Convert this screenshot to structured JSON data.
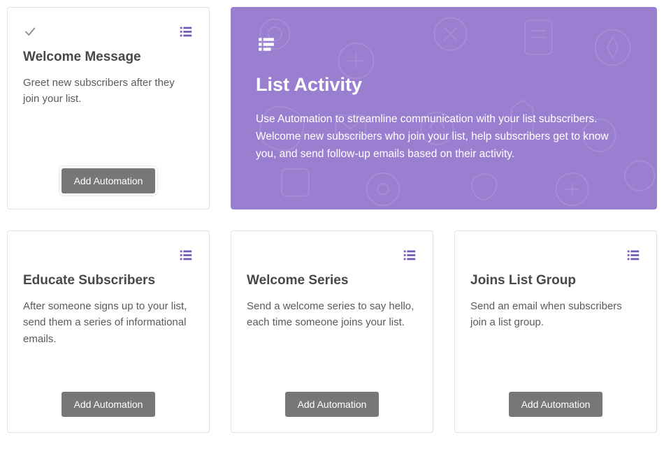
{
  "feature": {
    "title": "List Activity",
    "description": "Use Automation to streamline communication with your list subscribers. Welcome new subscribers who join your list, help subscribers get to know you, and send follow-up emails based on their activity."
  },
  "cards": {
    "welcome_message": {
      "title": "Welcome Message",
      "description": "Greet new subscribers after they join your list.",
      "button": "Add Automation"
    },
    "educate": {
      "title": "Educate Subscribers",
      "description": "After someone signs up to your list, send them a series of informational emails.",
      "button": "Add Automation"
    },
    "welcome_series": {
      "title": "Welcome Series",
      "description": "Send a welcome series to say hello, each time someone joins your list.",
      "button": "Add Automation"
    },
    "joins_group": {
      "title": "Joins List Group",
      "description": "Send an email when subscribers join a list group.",
      "button": "Add Automation"
    }
  },
  "colors": {
    "accent": "#9a7ed0",
    "list_icon": "#7558b3",
    "check_icon": "#8b8b8b"
  }
}
